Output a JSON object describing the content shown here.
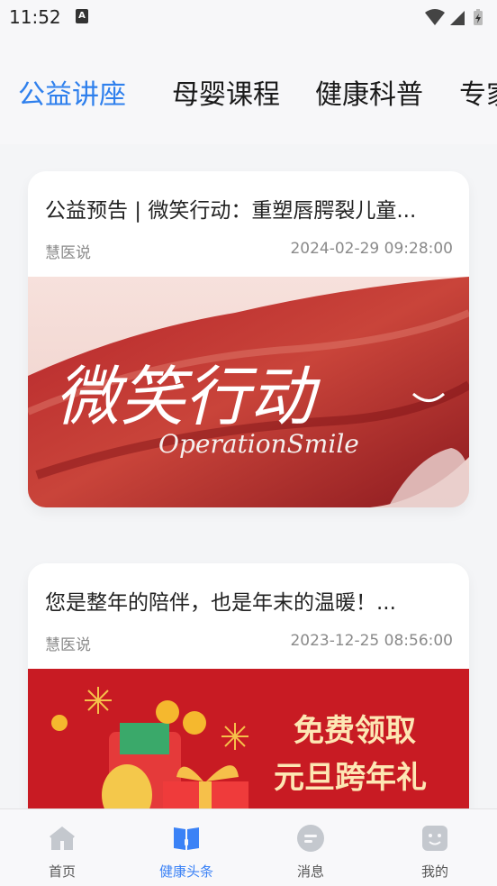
{
  "status_bar": {
    "time": "11:52",
    "notification_icon": "A"
  },
  "top_tabs": [
    {
      "label": "公益讲座",
      "active": true
    },
    {
      "label": "母婴课程",
      "active": false
    },
    {
      "label": "健康科普",
      "active": false
    },
    {
      "label": "专家",
      "active": false
    }
  ],
  "articles": [
    {
      "title": "公益预告 | 微笑行动：重塑唇腭裂儿童...",
      "source": "慧医说",
      "date": "2024-02-29 09:28:00",
      "image_text": {
        "main": "微笑行动",
        "sub": "OperationSmile"
      }
    },
    {
      "title": "您是整年的陪伴，也是年末的温暖！...",
      "source": "慧医说",
      "date": "2023-12-25 08:56:00",
      "image_text": {
        "line1": "免费领取",
        "line2": "元旦跨年礼"
      }
    }
  ],
  "bottom_nav": [
    {
      "label": "首页",
      "icon": "home-icon",
      "active": false
    },
    {
      "label": "健康头条",
      "icon": "book-icon",
      "active": true
    },
    {
      "label": "消息",
      "icon": "message-icon",
      "active": false
    },
    {
      "label": "我的",
      "icon": "profile-icon",
      "active": false
    }
  ],
  "colors": {
    "accent": "#2f80ed",
    "nav_active": "#3b82f6",
    "nav_inactive": "#c4c8ce",
    "banner_red": "#c81b23"
  }
}
